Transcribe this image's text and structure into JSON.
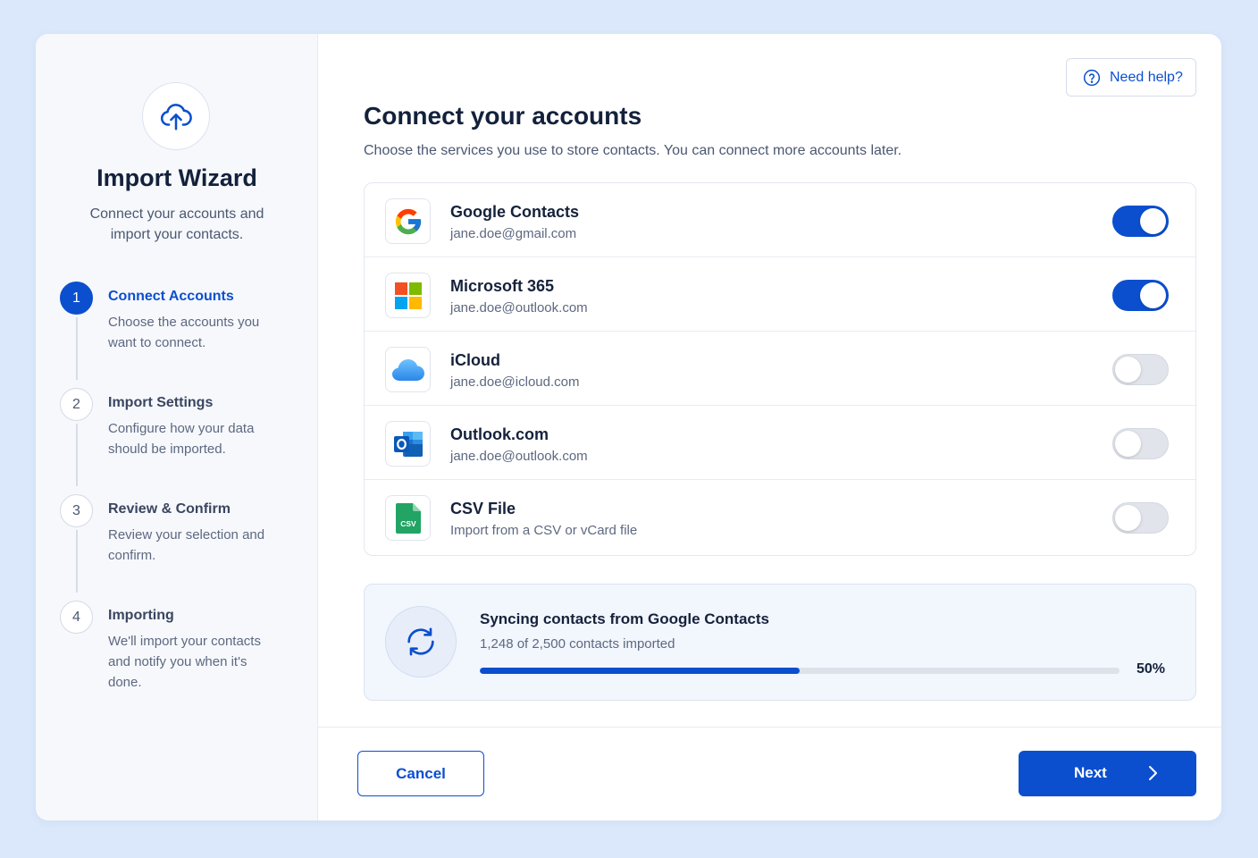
{
  "sidebar": {
    "title": "Import Wizard",
    "subtitle": "Connect your accounts and import your contacts.",
    "steps": [
      {
        "number": "1",
        "title": "Connect Accounts",
        "description": "Choose the accounts you want to connect."
      },
      {
        "number": "2",
        "title": "Import Settings",
        "description": "Configure how your data should be imported."
      },
      {
        "number": "3",
        "title": "Review & Confirm",
        "description": "Review your selection and confirm."
      },
      {
        "number": "4",
        "title": "Importing",
        "description": "We'll import your contacts and notify you when it's done."
      }
    ],
    "active_step": 1
  },
  "header": {
    "help_label": "Need help?"
  },
  "main": {
    "title": "Connect your accounts",
    "subtitle": "Choose the services you use to store contacts. You can connect more accounts later."
  },
  "accounts": [
    {
      "name": "Google Contacts",
      "detail": "jane.doe@gmail.com",
      "icon": "google-icon",
      "enabled": true
    },
    {
      "name": "Microsoft 365",
      "detail": "jane.doe@outlook.com",
      "icon": "microsoft-icon",
      "enabled": true
    },
    {
      "name": "iCloud",
      "detail": "jane.doe@icloud.com",
      "icon": "icloud-icon",
      "enabled": false
    },
    {
      "name": "Outlook.com",
      "detail": "jane.doe@outlook.com",
      "icon": "outlook-icon",
      "enabled": false
    },
    {
      "name": "CSV File",
      "detail": "Import from a CSV or vCard file",
      "icon": "csv-file-icon",
      "enabled": false
    }
  ],
  "csv_badge": "CSV",
  "sync": {
    "title": "Syncing contacts from Google Contacts",
    "subtitle": "1,248 of 2,500 contacts imported",
    "progress_percent": 50,
    "progress_label": "50%"
  },
  "footer": {
    "cancel_label": "Cancel",
    "next_label": "Next"
  },
  "colors": {
    "accent": "#0b4fcf",
    "background": "#dbe8fb",
    "toggle_off": "#e1e4ea"
  }
}
